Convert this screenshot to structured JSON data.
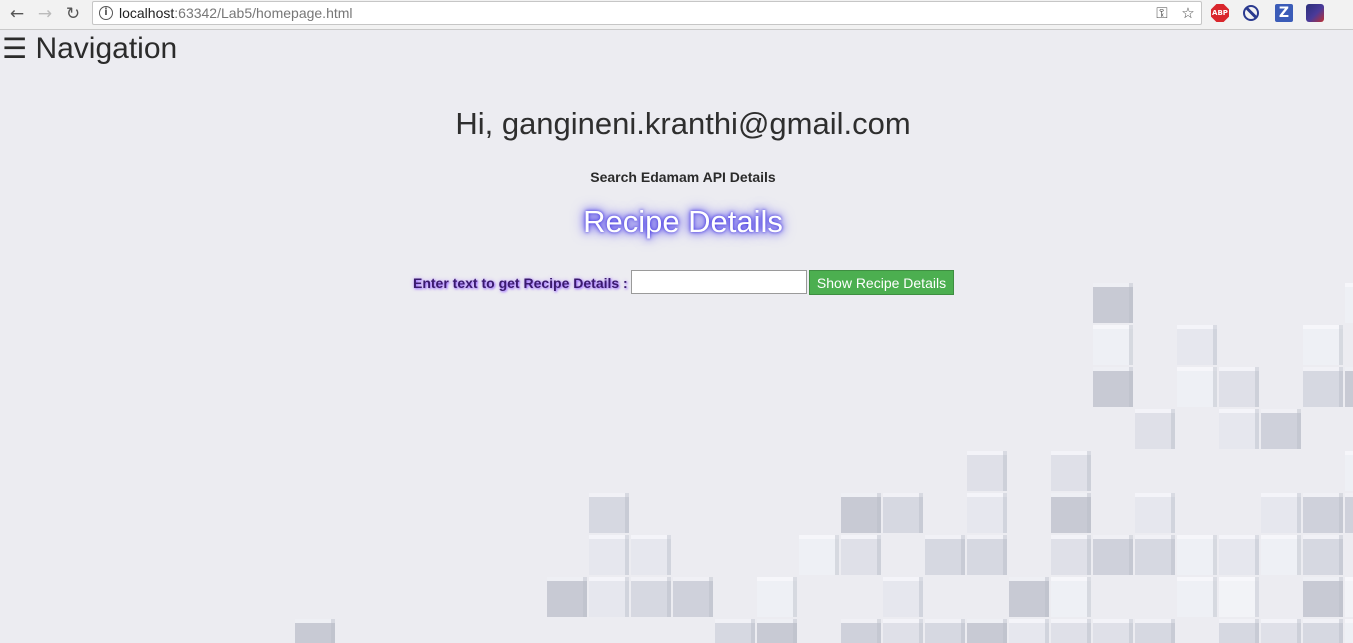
{
  "browser": {
    "url_host": "localhost",
    "url_path": ":63342/Lab5/homepage.html",
    "icons": {
      "back": "back-arrow-icon",
      "forward": "forward-arrow-icon",
      "reload": "reload-icon",
      "info": "site-info-icon",
      "key": "key-icon",
      "star": "bookmark-star-icon"
    },
    "extensions": [
      {
        "name": "adblock-plus-icon",
        "label": "ABP"
      },
      {
        "name": "block-icon",
        "label": ""
      },
      {
        "name": "zotero-icon",
        "label": "Z"
      },
      {
        "name": "extension-icon",
        "label": ""
      }
    ]
  },
  "page": {
    "nav_burger": "☰",
    "nav_title": "Navigation",
    "greeting": "Hi, gangineni.kranthi@gmail.com",
    "subheading": "Search Edamam API Details",
    "recipe_heading": "Recipe Details",
    "form": {
      "label": "Enter text to get Recipe Details :",
      "input_value": "",
      "button_label": "Show Recipe Details"
    }
  },
  "colors": {
    "button_bg": "#4caf50",
    "heading_glow": "#3b2ee0",
    "label_glow": "#9b6cff",
    "background": "#ececf1"
  }
}
